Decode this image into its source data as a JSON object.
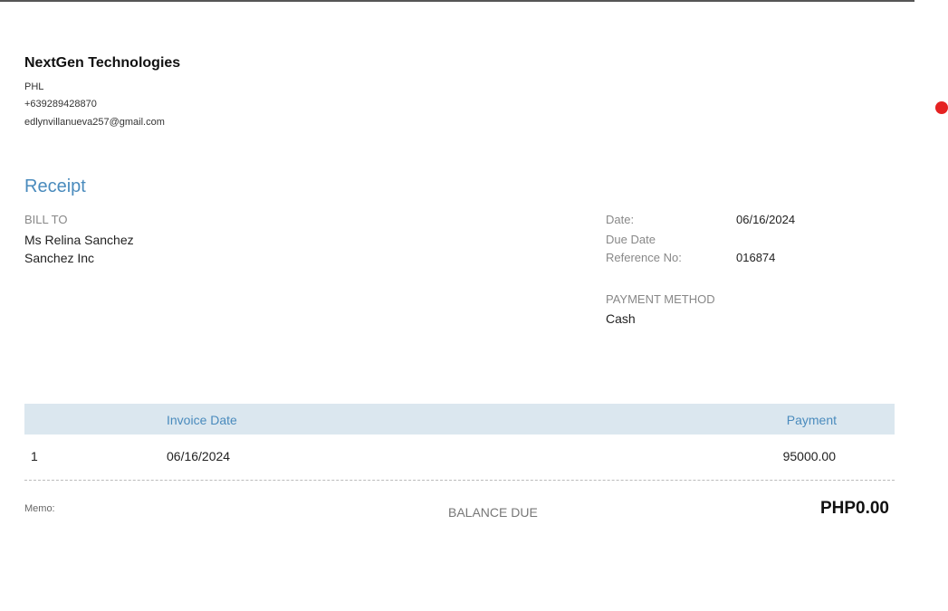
{
  "company": {
    "name": "NextGen Technologies",
    "country": "PHL",
    "phone": "+639289428870",
    "email": "edlynvillanueva257@gmail.com"
  },
  "document": {
    "title": "Receipt"
  },
  "bill_to": {
    "label": "BILL TO",
    "name": "Ms Relina Sanchez",
    "company": "Sanchez Inc"
  },
  "meta": {
    "date_label": "Date:",
    "date_value": "06/16/2024",
    "due_date_label": "Due Date",
    "due_date_value": "",
    "reference_label": "Reference No:",
    "reference_value": "016874"
  },
  "payment_method": {
    "label": "PAYMENT METHOD",
    "value": "Cash"
  },
  "table": {
    "headers": {
      "number": "",
      "invoice_date": "Invoice Date",
      "payment": "Payment"
    },
    "rows": [
      {
        "number": "1",
        "invoice_date": "06/16/2024",
        "payment": "95000.00"
      }
    ]
  },
  "footer": {
    "memo_label": "Memo:",
    "balance_due_label": "BALANCE DUE",
    "balance_due_value": "PHP0.00"
  },
  "colors": {
    "accent": "#4a8bbd",
    "table_header_bg": "#dbe7ef",
    "record_dot": "#e52222"
  }
}
